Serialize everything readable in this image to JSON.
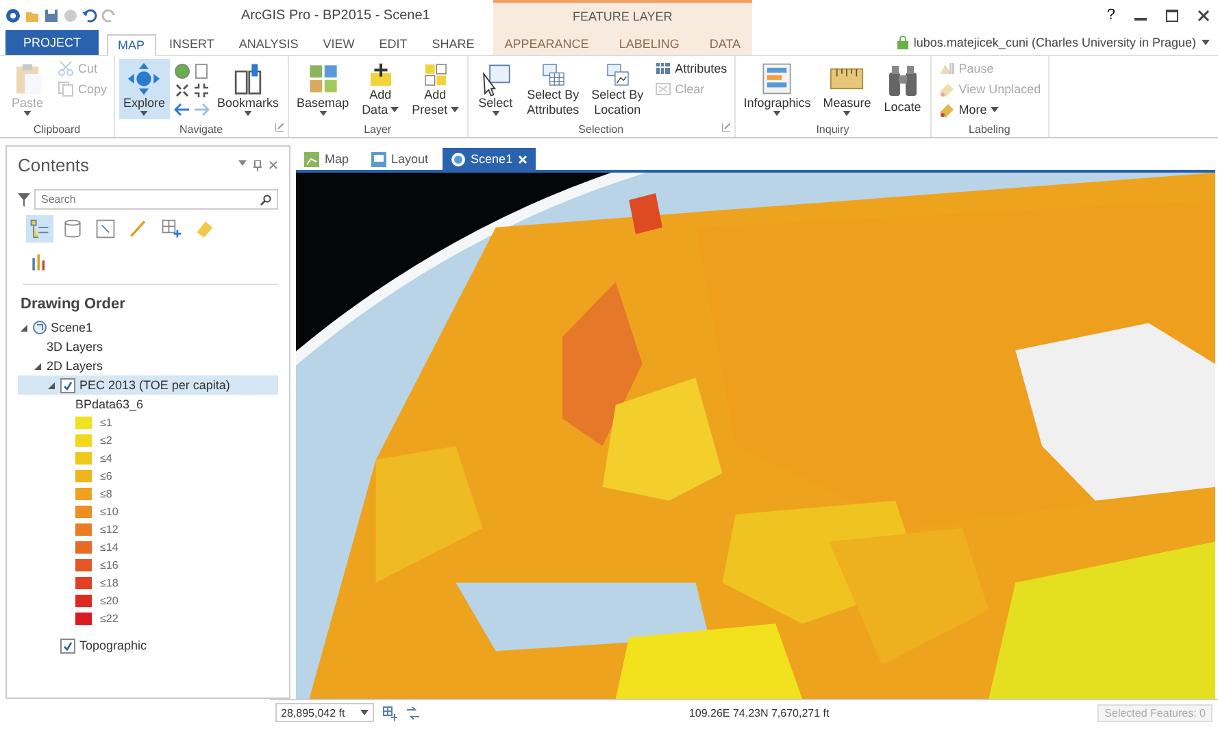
{
  "window": {
    "title": "ArcGIS Pro - BP2015 - Scene1",
    "context_group": "FEATURE LAYER",
    "help": "?",
    "user": "lubos.matejicek_cuni (Charles University in Prague)"
  },
  "ribbon_tabs": [
    {
      "label": "PROJECT",
      "kind": "file",
      "selected": false
    },
    {
      "label": "MAP",
      "kind": "normal",
      "selected": true
    },
    {
      "label": "INSERT",
      "kind": "normal",
      "selected": false
    },
    {
      "label": "ANALYSIS",
      "kind": "normal",
      "selected": false
    },
    {
      "label": "VIEW",
      "kind": "normal",
      "selected": false
    },
    {
      "label": "EDIT",
      "kind": "normal",
      "selected": false
    },
    {
      "label": "SHARE",
      "kind": "normal",
      "selected": false
    },
    {
      "label": "APPEARANCE",
      "kind": "contextual",
      "selected": false
    },
    {
      "label": "LABELING",
      "kind": "contextual",
      "selected": false
    },
    {
      "label": "DATA",
      "kind": "contextual",
      "selected": false
    }
  ],
  "ribbon_groups": [
    {
      "label": "Clipboard",
      "launcher": false,
      "items": [
        {
          "kind": "large",
          "lines": [
            "Paste"
          ],
          "dropdown": true,
          "disabled": true,
          "selected": false
        },
        {
          "kind": "stack",
          "items": [
            {
              "label": "Cut",
              "disabled": true,
              "dropdown": false
            },
            {
              "label": "Copy",
              "disabled": true,
              "dropdown": false
            }
          ]
        }
      ]
    },
    {
      "label": "Navigate",
      "launcher": true,
      "items": [
        {
          "kind": "large",
          "lines": [
            "Explore"
          ],
          "dropdown": true,
          "disabled": false,
          "selected": true
        },
        {
          "kind": "navpad"
        },
        {
          "kind": "large",
          "lines": [
            "Bookmarks"
          ],
          "dropdown": true,
          "disabled": false,
          "selected": false
        }
      ]
    },
    {
      "label": "Layer",
      "launcher": false,
      "items": [
        {
          "kind": "large",
          "lines": [
            "Basemap"
          ],
          "dropdown": true,
          "disabled": false,
          "selected": false
        },
        {
          "kind": "large",
          "lines": [
            "Add",
            "Data"
          ],
          "dropdown": true,
          "disabled": false,
          "selected": false
        },
        {
          "kind": "large",
          "lines": [
            "Add",
            "Preset"
          ],
          "dropdown": true,
          "disabled": false,
          "selected": false
        }
      ]
    },
    {
      "label": "Selection",
      "launcher": true,
      "items": [
        {
          "kind": "large",
          "lines": [
            "Select"
          ],
          "dropdown": true,
          "disabled": false,
          "selected": false
        },
        {
          "kind": "large",
          "lines": [
            "Select By",
            "Attributes"
          ],
          "dropdown": false,
          "disabled": false,
          "selected": false
        },
        {
          "kind": "large",
          "lines": [
            "Select By",
            "Location"
          ],
          "dropdown": false,
          "disabled": false,
          "selected": false
        },
        {
          "kind": "stack",
          "items": [
            {
              "label": "Attributes",
              "disabled": false,
              "dropdown": false
            },
            {
              "label": "Clear",
              "disabled": true,
              "dropdown": false
            }
          ]
        }
      ]
    },
    {
      "label": "Inquiry",
      "launcher": false,
      "items": [
        {
          "kind": "large",
          "lines": [
            "Infographics"
          ],
          "dropdown": true,
          "disabled": false,
          "selected": false
        },
        {
          "kind": "large",
          "lines": [
            "Measure"
          ],
          "dropdown": true,
          "disabled": false,
          "selected": false
        },
        {
          "kind": "large",
          "lines": [
            "Locate"
          ],
          "dropdown": false,
          "disabled": false,
          "selected": false
        }
      ]
    },
    {
      "label": "Labeling",
      "launcher": false,
      "items": [
        {
          "kind": "stack",
          "items": [
            {
              "label": "Pause",
              "disabled": true,
              "dropdown": false
            },
            {
              "label": "View Unplaced",
              "disabled": true,
              "dropdown": false
            },
            {
              "label": "More",
              "disabled": false,
              "dropdown": true
            }
          ]
        }
      ]
    }
  ],
  "contents": {
    "title": "Contents",
    "search": {
      "placeholder": "Search"
    },
    "view_buttons": [
      {
        "selected": true
      },
      {
        "selected": false
      },
      {
        "selected": false
      },
      {
        "selected": false
      },
      {
        "selected": false
      },
      {
        "selected": false
      },
      {
        "selected": false
      }
    ],
    "section_title": "Drawing Order",
    "tree": [
      {
        "label": "Scene1",
        "kind": "scene",
        "expanded": true,
        "children": [
          {
            "label": "3D Layers"
          },
          {
            "label": "2D Layers",
            "expanded": true,
            "children": [
              {
                "label": "PEC 2013 (TOE per capita)",
                "kind": "layer",
                "expanded": true,
                "checked": true,
                "selected": true,
                "legend": {
                  "field": "BPdata63_6",
                  "classes": [
                    {
                      "label": "≤1",
                      "color": "#f2e21e"
                    },
                    {
                      "label": "≤2",
                      "color": "#f1d81c"
                    },
                    {
                      "label": "≤4",
                      "color": "#f0c81c"
                    },
                    {
                      "label": "≤6",
                      "color": "#efb51d"
                    },
                    {
                      "label": "≤8",
                      "color": "#eea21f"
                    },
                    {
                      "label": "≤10",
                      "color": "#ec8f22"
                    },
                    {
                      "label": "≤12",
                      "color": "#ea7d24"
                    },
                    {
                      "label": "≤14",
                      "color": "#e86a25"
                    },
                    {
                      "label": "≤16",
                      "color": "#e55625"
                    },
                    {
                      "label": "≤18",
                      "color": "#e24024"
                    },
                    {
                      "label": "≤20",
                      "color": "#de2a22"
                    },
                    {
                      "label": "≤22",
                      "color": "#d91a20"
                    }
                  ]
                }
              },
              {
                "label": "Topographic",
                "kind": "layer",
                "checked": true,
                "selected": false
              }
            ]
          }
        ]
      }
    ]
  },
  "view_tabs": [
    {
      "label": "Map",
      "kind": "map",
      "selected": false
    },
    {
      "label": "Layout",
      "kind": "layout",
      "selected": false
    },
    {
      "label": "Scene1",
      "kind": "scene",
      "selected": true
    }
  ],
  "status_bar": {
    "scale": "28,895,042 ft",
    "coordinates": "109.26E 74.23N  7,670,271 ft",
    "selected_features": {
      "label": "Selected Features: 0",
      "disabled": true
    }
  }
}
